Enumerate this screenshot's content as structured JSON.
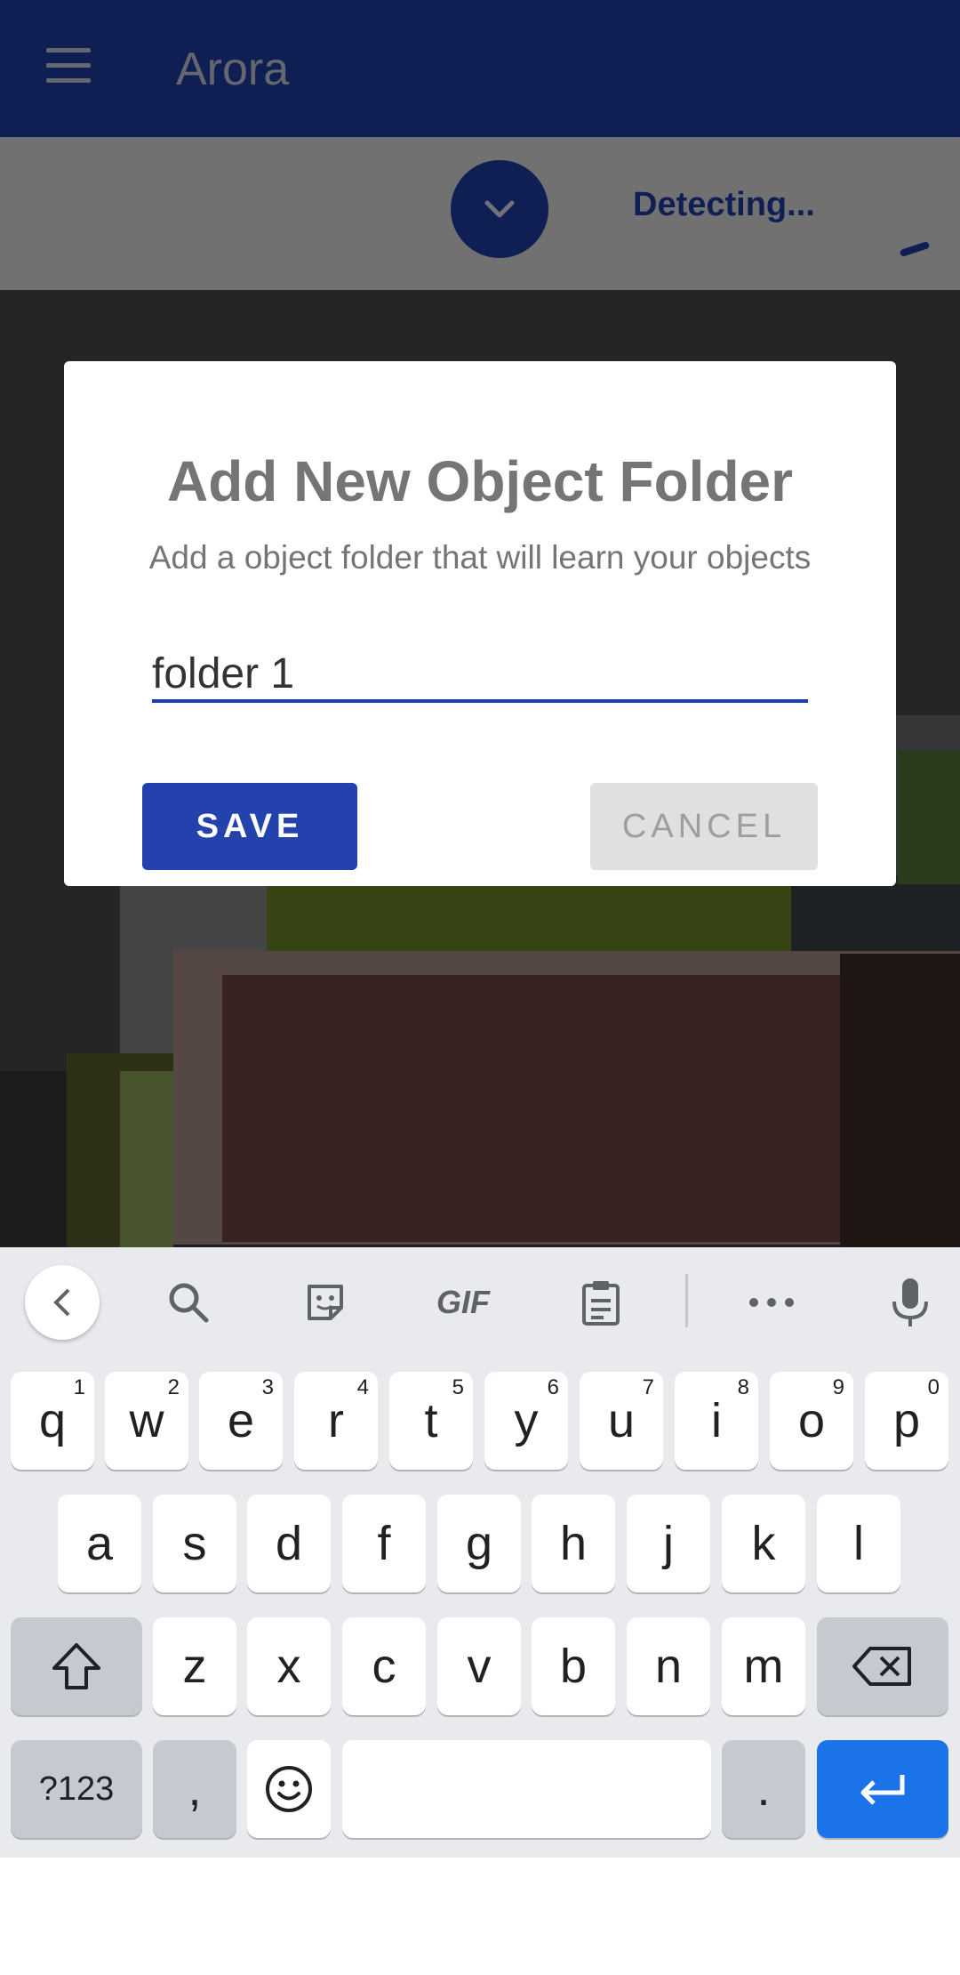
{
  "app_bar": {
    "title": "Arora",
    "color": "#1f3fa8"
  },
  "detect_bar": {
    "status": "Detecting..."
  },
  "dialog": {
    "title": "Add New Object Folder",
    "subtitle": "Add a object folder that will learn your objects",
    "input_value": "folder 1",
    "save_label": "SAVE",
    "cancel_label": "CANCEL"
  },
  "keyboard": {
    "toolbar_icons": [
      "back-icon",
      "search-icon",
      "sticker-icon",
      "gif",
      "clipboard-icon",
      "more-icon",
      "mic-icon"
    ],
    "gif_label": "GIF",
    "row1": [
      {
        "key": "q",
        "hint": "1"
      },
      {
        "key": "w",
        "hint": "2"
      },
      {
        "key": "e",
        "hint": "3"
      },
      {
        "key": "r",
        "hint": "4"
      },
      {
        "key": "t",
        "hint": "5"
      },
      {
        "key": "y",
        "hint": "6"
      },
      {
        "key": "u",
        "hint": "7"
      },
      {
        "key": "i",
        "hint": "8"
      },
      {
        "key": "o",
        "hint": "9"
      },
      {
        "key": "p",
        "hint": "0"
      }
    ],
    "row2": [
      "a",
      "s",
      "d",
      "f",
      "g",
      "h",
      "j",
      "k",
      "l"
    ],
    "row3": [
      "z",
      "x",
      "c",
      "v",
      "b",
      "n",
      "m"
    ],
    "symbols_label": "?123",
    "comma_label": ",",
    "period_label": ".",
    "enter_color": "#1a73e8"
  }
}
